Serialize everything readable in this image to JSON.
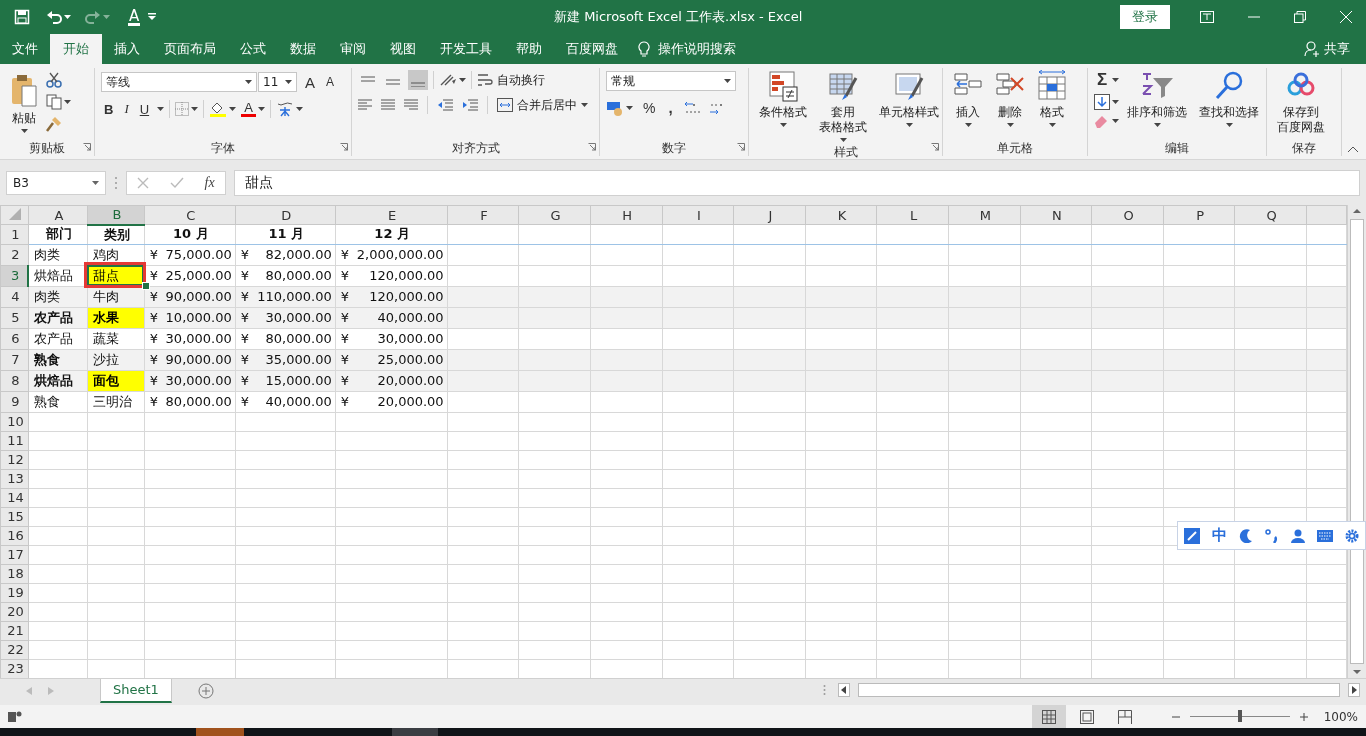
{
  "title_bar": {
    "font_color_letter": "A",
    "title": "新建 Microsoft Excel 工作表.xlsx  -  Excel",
    "login_button": "登录"
  },
  "menu_tabs": [
    {
      "label": "文件",
      "selected": false
    },
    {
      "label": "开始",
      "selected": true
    },
    {
      "label": "插入",
      "selected": false
    },
    {
      "label": "页面布局",
      "selected": false
    },
    {
      "label": "公式",
      "selected": false
    },
    {
      "label": "数据",
      "selected": false
    },
    {
      "label": "审阅",
      "selected": false
    },
    {
      "label": "视图",
      "selected": false
    },
    {
      "label": "开发工具",
      "selected": false
    },
    {
      "label": "帮助",
      "selected": false
    },
    {
      "label": "百度网盘",
      "selected": false
    }
  ],
  "tell_me": "操作说明搜索",
  "share": "共享",
  "ribbon": {
    "clipboard": {
      "title": "剪贴板",
      "paste": "粘贴"
    },
    "font": {
      "title": "字体",
      "font_name": "等线",
      "font_size": "11",
      "grow": "A",
      "shrink": "A",
      "bold": "B",
      "italic": "I",
      "underline": "U",
      "font_color": "A"
    },
    "alignment": {
      "title": "对齐方式",
      "vertical_align": [
        {
          "selected": false
        },
        {
          "selected": false
        },
        {
          "selected": true
        }
      ],
      "wrap_text": "自动换行",
      "merge_center": "合并后居中"
    },
    "number": {
      "title": "数字",
      "format": "常规",
      "percent": "%",
      "comma": ","
    },
    "styles": {
      "title": "样式",
      "buttons": [
        {
          "lines": [
            "条件格式"
          ]
        },
        {
          "lines": [
            "套用",
            "表格格式"
          ]
        },
        {
          "lines": [
            "单元格样式"
          ]
        }
      ]
    },
    "cells": {
      "title": "单元格",
      "buttons": [
        {
          "lines": [
            "插入"
          ]
        },
        {
          "lines": [
            "删除"
          ]
        },
        {
          "lines": [
            "格式"
          ]
        }
      ]
    },
    "editing": {
      "title": "编辑",
      "sum": "Σ",
      "buttons": [
        {
          "lines": [
            "排序和筛选"
          ]
        },
        {
          "lines": [
            "查找和选择"
          ]
        }
      ]
    },
    "save": {
      "title": "保存",
      "buttons": [
        {
          "lines": [
            "保存到",
            "百度网盘"
          ]
        }
      ]
    }
  },
  "formula_bar": {
    "name_box": "B3",
    "function_label": "fx",
    "value": "甜点"
  },
  "sheet": {
    "columns": [
      {
        "label": "A",
        "selected": false
      },
      {
        "label": "B",
        "selected": true
      },
      {
        "label": "C",
        "selected": false
      },
      {
        "label": "D",
        "selected": false
      },
      {
        "label": "E",
        "selected": false
      },
      {
        "label": "F",
        "selected": false
      },
      {
        "label": "G",
        "selected": false
      },
      {
        "label": "H",
        "selected": false
      },
      {
        "label": "I",
        "selected": false
      },
      {
        "label": "J",
        "selected": false
      },
      {
        "label": "K",
        "selected": false
      },
      {
        "label": "L",
        "selected": false
      },
      {
        "label": "M",
        "selected": false
      },
      {
        "label": "N",
        "selected": false
      },
      {
        "label": "O",
        "selected": false
      },
      {
        "label": "P",
        "selected": false
      },
      {
        "label": "Q",
        "selected": false
      }
    ],
    "rows": [
      {
        "number": "1",
        "selected": false,
        "shaded": false,
        "cells": [
          {
            "kind": "heading",
            "text": "部门",
            "bold": true,
            "highlighted": false
          },
          {
            "kind": "heading",
            "text": "类别",
            "bold": true,
            "highlighted": false
          },
          {
            "kind": "heading",
            "text": "10 月",
            "bold": true,
            "highlighted": false
          },
          {
            "kind": "heading",
            "text": "11 月",
            "bold": true,
            "highlighted": false
          },
          {
            "kind": "heading",
            "text": "12 月",
            "bold": true,
            "highlighted": false
          }
        ]
      },
      {
        "number": "2",
        "selected": false,
        "shaded": false,
        "cells": [
          {
            "kind": "text",
            "text": "肉类",
            "bold": false,
            "highlighted": false
          },
          {
            "kind": "text",
            "text": "鸡肉",
            "bold": false,
            "highlighted": false
          },
          {
            "kind": "currency",
            "symbol": "¥",
            "amount": "75,000.00"
          },
          {
            "kind": "currency",
            "symbol": "¥",
            "amount": "82,000.00"
          },
          {
            "kind": "currency",
            "symbol": "¥",
            "amount": "2,000,000.00"
          }
        ]
      },
      {
        "number": "3",
        "selected": true,
        "shaded": false,
        "cells": [
          {
            "kind": "text",
            "text": "烘焙品",
            "bold": false,
            "highlighted": false
          },
          {
            "kind": "text",
            "text": "甜点",
            "bold": false,
            "highlighted": true
          },
          {
            "kind": "currency",
            "symbol": "¥",
            "amount": "25,000.00"
          },
          {
            "kind": "currency",
            "symbol": "¥",
            "amount": "80,000.00"
          },
          {
            "kind": "currency",
            "symbol": "¥",
            "amount": "120,000.00"
          }
        ]
      },
      {
        "number": "4",
        "selected": false,
        "shaded": true,
        "cells": [
          {
            "kind": "text",
            "text": "肉类",
            "bold": false,
            "highlighted": false
          },
          {
            "kind": "text",
            "text": "牛肉",
            "bold": false,
            "highlighted": false
          },
          {
            "kind": "currency",
            "symbol": "¥",
            "amount": "90,000.00"
          },
          {
            "kind": "currency",
            "symbol": "¥",
            "amount": "110,000.00"
          },
          {
            "kind": "currency",
            "symbol": "¥",
            "amount": "120,000.00"
          }
        ]
      },
      {
        "number": "5",
        "selected": false,
        "shaded": true,
        "cells": [
          {
            "kind": "text",
            "text": "农产品",
            "bold": true,
            "highlighted": false
          },
          {
            "kind": "text",
            "text": "水果",
            "bold": true,
            "highlighted": true
          },
          {
            "kind": "currency",
            "symbol": "¥",
            "amount": "10,000.00"
          },
          {
            "kind": "currency",
            "symbol": "¥",
            "amount": "30,000.00"
          },
          {
            "kind": "currency",
            "symbol": "¥",
            "amount": "40,000.00"
          }
        ]
      },
      {
        "number": "6",
        "selected": false,
        "shaded": false,
        "cells": [
          {
            "kind": "text",
            "text": "农产品",
            "bold": false,
            "highlighted": false
          },
          {
            "kind": "text",
            "text": "蔬菜",
            "bold": false,
            "highlighted": false
          },
          {
            "kind": "currency",
            "symbol": "¥",
            "amount": "30,000.00"
          },
          {
            "kind": "currency",
            "symbol": "¥",
            "amount": "80,000.00"
          },
          {
            "kind": "currency",
            "symbol": "¥",
            "amount": "30,000.00"
          }
        ]
      },
      {
        "number": "7",
        "selected": false,
        "shaded": true,
        "cells": [
          {
            "kind": "text",
            "text": "熟食",
            "bold": true,
            "highlighted": false
          },
          {
            "kind": "text",
            "text": "沙拉",
            "bold": false,
            "highlighted": false
          },
          {
            "kind": "currency",
            "symbol": "¥",
            "amount": "90,000.00"
          },
          {
            "kind": "currency",
            "symbol": "¥",
            "amount": "35,000.00"
          },
          {
            "kind": "currency",
            "symbol": "¥",
            "amount": "25,000.00"
          }
        ]
      },
      {
        "number": "8",
        "selected": false,
        "shaded": true,
        "cells": [
          {
            "kind": "text",
            "text": "烘焙品",
            "bold": true,
            "highlighted": false
          },
          {
            "kind": "text",
            "text": "面包",
            "bold": true,
            "highlighted": true
          },
          {
            "kind": "currency",
            "symbol": "¥",
            "amount": "30,000.00"
          },
          {
            "kind": "currency",
            "symbol": "¥",
            "amount": "15,000.00"
          },
          {
            "kind": "currency",
            "symbol": "¥",
            "amount": "20,000.00"
          }
        ]
      },
      {
        "number": "9",
        "selected": false,
        "shaded": false,
        "cells": [
          {
            "kind": "text",
            "text": "熟食",
            "bold": false,
            "highlighted": false
          },
          {
            "kind": "text",
            "text": "三明治",
            "bold": false,
            "highlighted": false
          },
          {
            "kind": "currency",
            "symbol": "¥",
            "amount": "80,000.00"
          },
          {
            "kind": "currency",
            "symbol": "¥",
            "amount": "40,000.00"
          },
          {
            "kind": "currency",
            "symbol": "¥",
            "amount": "20,000.00"
          }
        ]
      },
      {
        "number": "10",
        "selected": false,
        "shaded": false
      },
      {
        "number": "11",
        "selected": false,
        "shaded": false
      },
      {
        "number": "12",
        "selected": false,
        "shaded": false
      },
      {
        "number": "13",
        "selected": false,
        "shaded": false
      },
      {
        "number": "14",
        "selected": false,
        "shaded": false
      },
      {
        "number": "15",
        "selected": false,
        "shaded": false
      },
      {
        "number": "16",
        "selected": false,
        "shaded": false
      },
      {
        "number": "17",
        "selected": false,
        "shaded": false
      },
      {
        "number": "18",
        "selected": false,
        "shaded": false
      },
      {
        "number": "19",
        "selected": false,
        "shaded": false
      },
      {
        "number": "20",
        "selected": false,
        "shaded": false
      },
      {
        "number": "21",
        "selected": false,
        "shaded": false
      },
      {
        "number": "22",
        "selected": false,
        "shaded": false
      },
      {
        "number": "23",
        "selected": false,
        "shaded": false
      }
    ]
  },
  "ime_toolbar": {
    "mode": "中"
  },
  "sheet_tabs": [
    {
      "label": "Sheet1",
      "selected": true
    }
  ],
  "status_bar": {
    "views": [
      {
        "selected": true
      },
      {
        "selected": false
      },
      {
        "selected": false
      }
    ],
    "zoom_slider": {
      "level": 0.5
    },
    "zoom": "100%"
  }
}
